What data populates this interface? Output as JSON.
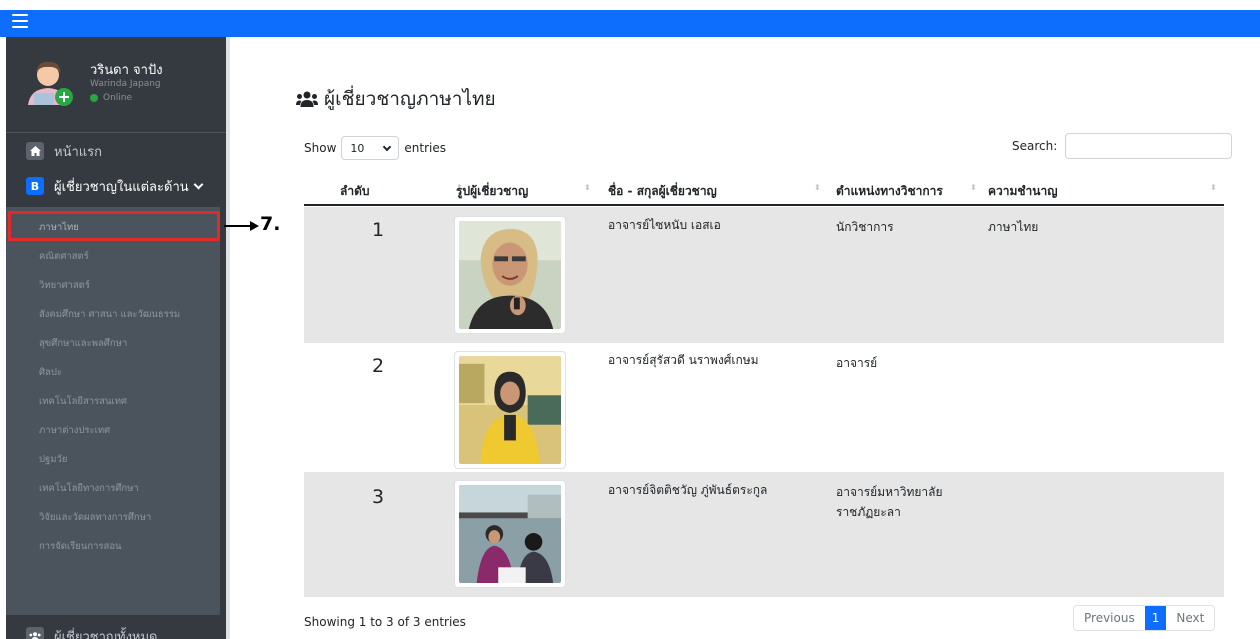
{
  "user": {
    "name": "วรินดา จาปัง",
    "name_en": "Warinda Japang",
    "status": "Online"
  },
  "sidebar": {
    "home_label": "หน้าแรก",
    "experts_label": "ผู้เชี่ยวชาญในแต่ละด้าน",
    "experts_icon_letter": "B",
    "subitems": [
      "ภาษาไทย",
      "คณิตศาสตร์",
      "วิทยาศาสตร์",
      "สังคมศึกษา ศาสนา และวัฒนธรรม",
      "สุขศึกษาและพลศึกษา",
      "ศิลปะ",
      "เทคโนโลยีสารสนเทศ",
      "ภาษาต่างประเทศ",
      "ปฐมวัย",
      "เทคโนโลยีทางการศึกษา",
      "วิจัยและวัดผลทางการศึกษา",
      "การจัดเรียนการสอน"
    ],
    "all_experts_label": "ผู้เชี่ยวชาญทั้งหมด"
  },
  "annotation": {
    "step": "7."
  },
  "main": {
    "title": "ผู้เชี่ยวชาญภาษาไทย",
    "show_label": "Show",
    "entries_value": "10",
    "entries_label": "entries",
    "search_label": "Search:",
    "columns": [
      "ลำดับ",
      "รูปผู้เชี่ยวชาญ",
      "ชื่อ - สกุลผู้เชี่ยวชาญ",
      "ตำแหน่งทางวิชาการ",
      "ความชำนาญ"
    ],
    "rows": [
      {
        "index": "1",
        "name": "อาจารย์ไซหนับ เอสเอ",
        "position": "นักวิชาการ",
        "expertise": "ภาษาไทย"
      },
      {
        "index": "2",
        "name": "อาจารย์สุรัสวดี นราพงศ์เกษม",
        "position": "อาจารย์",
        "expertise": ""
      },
      {
        "index": "3",
        "name": "อาจารย์จิตติชวัญ ภู่พันธ์ตระกูล",
        "position": "อาจารย์มหาวิทยาลัย ราชภัฏยะลา",
        "expertise": ""
      }
    ],
    "info": "Showing 1 to 3 of 3 entries",
    "pagination": {
      "prev": "Previous",
      "current": "1",
      "next": "Next"
    }
  }
}
